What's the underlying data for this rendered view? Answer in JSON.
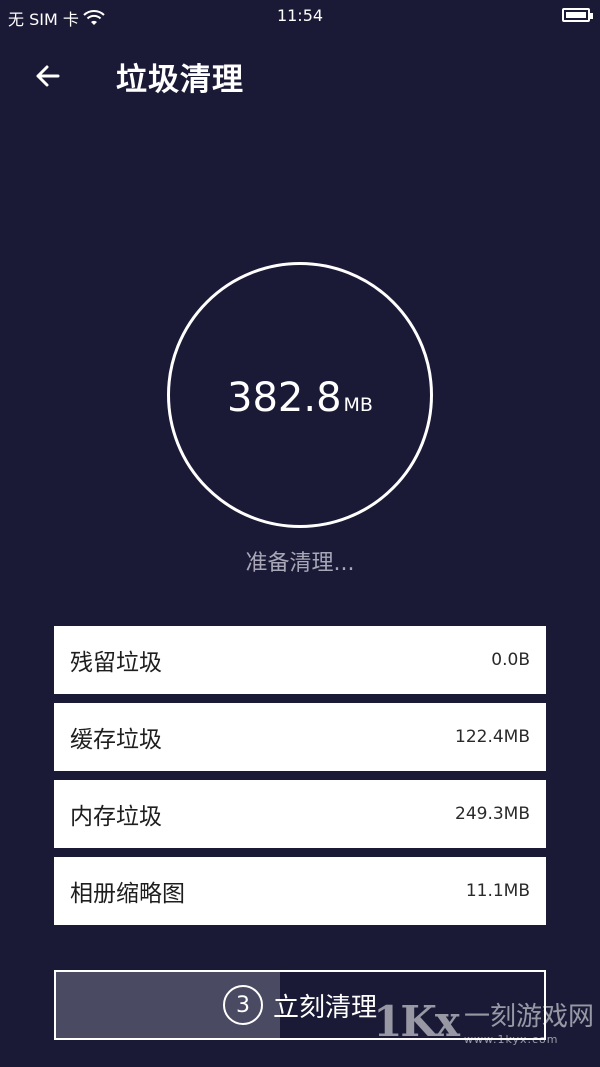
{
  "status_bar": {
    "carrier": "无 SIM 卡",
    "time": "11:54"
  },
  "header": {
    "title": "垃圾清理"
  },
  "summary": {
    "size_value": "382.8",
    "size_unit": "MB",
    "status": "准备清理..."
  },
  "items": [
    {
      "label": "残留垃圾",
      "value": "0.0B"
    },
    {
      "label": "缓存垃圾",
      "value": "122.4MB"
    },
    {
      "label": "内存垃圾",
      "value": "249.3MB"
    },
    {
      "label": "相册缩略图",
      "value": "11.1MB"
    }
  ],
  "clean_button": {
    "countdown": "3",
    "label": "立刻清理",
    "progress": 0.46
  },
  "watermark": {
    "logo": "1Kx",
    "text": "一刻游戏网",
    "url": "www.1kyx.com"
  },
  "icons": {
    "back": "arrow-left-icon",
    "wifi": "wifi-icon",
    "battery": "battery-icon"
  },
  "colors": {
    "background": "#1a1a37",
    "card": "#ffffff",
    "progress": "#4b4a63",
    "status_text": "#a7a7b7"
  }
}
